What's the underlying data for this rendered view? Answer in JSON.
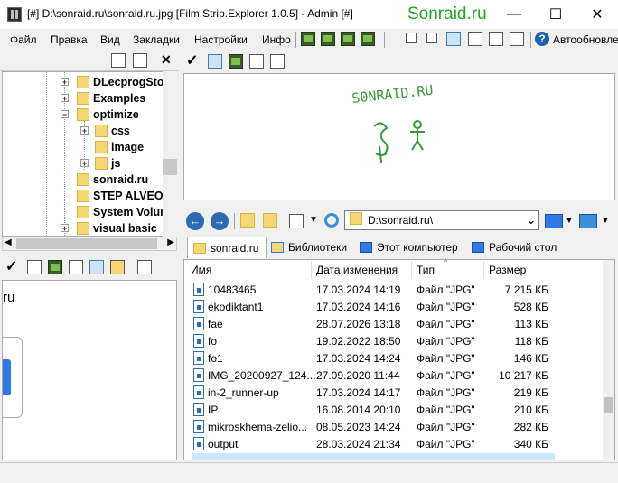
{
  "window": {
    "title": "[#] D:\\sonraid.ru\\sonraid.ru.jpg  [Film.Strip.Explorer 1.0.5]  - Admin [#]",
    "watermark": "Sonraid.ru",
    "minimize": "—",
    "maximize": "☐",
    "close": "✕"
  },
  "menu": {
    "items": [
      "Файл",
      "Правка",
      "Вид",
      "Закладки",
      "Настройки",
      "Инфо"
    ],
    "help_icon": "?",
    "autoupdate": "Автообновле"
  },
  "tree": {
    "items": [
      {
        "label": "DLecprogStoc",
        "expandable": true,
        "expanded": false
      },
      {
        "label": "Examples",
        "expandable": true,
        "expanded": false
      },
      {
        "label": "optimize",
        "expandable": true,
        "expanded": true
      },
      {
        "label": "css",
        "expandable": true,
        "expanded": false
      },
      {
        "label": "image",
        "expandable": false,
        "expanded": false
      },
      {
        "label": "js",
        "expandable": true,
        "expanded": false
      },
      {
        "label": "sonraid.ru",
        "expandable": false,
        "expanded": false
      },
      {
        "label": "STEP ALVEOO",
        "expandable": false,
        "expanded": false
      },
      {
        "label": "System Volun",
        "expandable": false,
        "expanded": false
      },
      {
        "label": "visual basic",
        "expandable": true,
        "expanded": false
      }
    ]
  },
  "thumbs": {
    "partial_label": "ru"
  },
  "preview": {
    "handwriting": "S0NRAID.RU"
  },
  "navigation": {
    "back_icon": "arrow-left-icon",
    "forward_icon": "arrow-right-icon",
    "address": "D:\\sonraid.ru\\",
    "address_dropdown": "⌄"
  },
  "tabs": [
    {
      "label": "sonraid.ru",
      "active": true,
      "icon": "folder-icon"
    },
    {
      "label": "Библиотеки",
      "active": false,
      "icon": "libraries-icon"
    },
    {
      "label": "Этот компьютер",
      "active": false,
      "icon": "computer-icon"
    },
    {
      "label": "Рабочий стол",
      "active": false,
      "icon": "desktop-icon"
    }
  ],
  "file_list": {
    "columns": [
      "Имя",
      "Дата изменения",
      "Тип",
      "Размер"
    ],
    "rows": [
      {
        "name": "10483465",
        "date": "17.03.2024 14:19",
        "type": "Файл \"JPG\"",
        "size": "7 215 КБ"
      },
      {
        "name": "ekodiktant1",
        "date": "17.03.2024 14:16",
        "type": "Файл \"JPG\"",
        "size": "528 КБ"
      },
      {
        "name": "fae",
        "date": "28.07.2026 13:18",
        "type": "Файл \"JPG\"",
        "size": "113 КБ"
      },
      {
        "name": "fo",
        "date": "19.02.2022 18:50",
        "type": "Файл \"JPG\"",
        "size": "118 КБ"
      },
      {
        "name": "fo1",
        "date": "17.03.2024 14:24",
        "type": "Файл \"JPG\"",
        "size": "146 КБ"
      },
      {
        "name": "IMG_20200927_124...",
        "date": "27.09.2020 11:44",
        "type": "Файл \"JPG\"",
        "size": "10 217 КБ"
      },
      {
        "name": "in-2_runner-up",
        "date": "17.03.2024 14:17",
        "type": "Файл \"JPG\"",
        "size": "219 КБ"
      },
      {
        "name": "IP",
        "date": "16.08.2014 20:10",
        "type": "Файл \"JPG\"",
        "size": "210 КБ"
      },
      {
        "name": "mikroskhema-zelio...",
        "date": "08.05.2023 14:24",
        "type": "Файл \"JPG\"",
        "size": "282 КБ"
      },
      {
        "name": "output",
        "date": "28.03.2024 21:34",
        "type": "Файл \"JPG\"",
        "size": "340 КБ"
      }
    ]
  }
}
